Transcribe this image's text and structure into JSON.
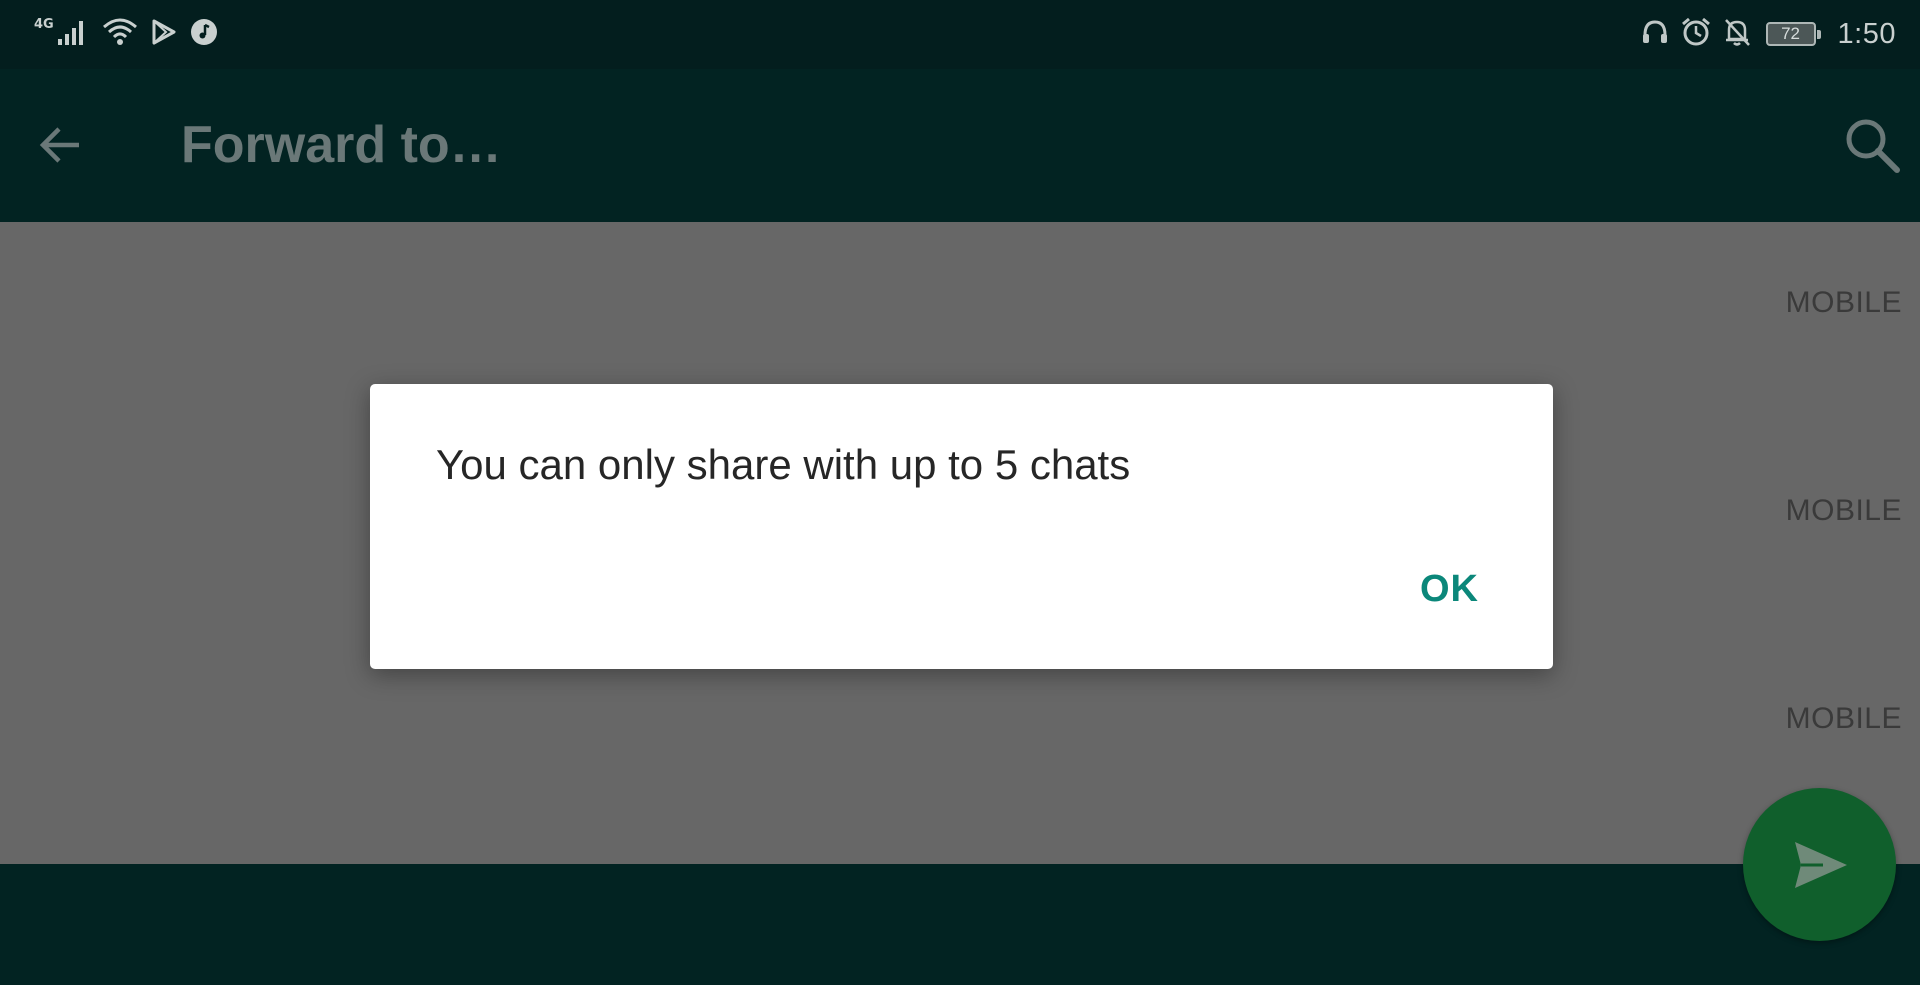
{
  "status_bar": {
    "network_label": "4G",
    "battery_level": "72",
    "time": "1:50",
    "icons": [
      "signal-icon",
      "wifi-icon",
      "play-store-icon",
      "music-icon",
      "headphones-icon",
      "alarm-icon",
      "notifications-off-icon",
      "battery-icon"
    ]
  },
  "app_bar": {
    "title": "Forward to…",
    "back_icon": "arrow-left-icon",
    "search_icon": "search-icon"
  },
  "contacts": [
    {
      "type": "MOBILE"
    },
    {
      "type": "MOBILE"
    },
    {
      "type": "MOBILE"
    }
  ],
  "fab": {
    "icon": "send-icon"
  },
  "dialog": {
    "message": "You can only share with up to 5 chats",
    "ok_label": "OK"
  },
  "colors": {
    "status_bar_bg": "#031e1e",
    "app_bar_bg": "#022322",
    "scrim_list_bg": "#676767",
    "dialog_accent": "#0b877a",
    "fab_bg": "#105f2c"
  }
}
